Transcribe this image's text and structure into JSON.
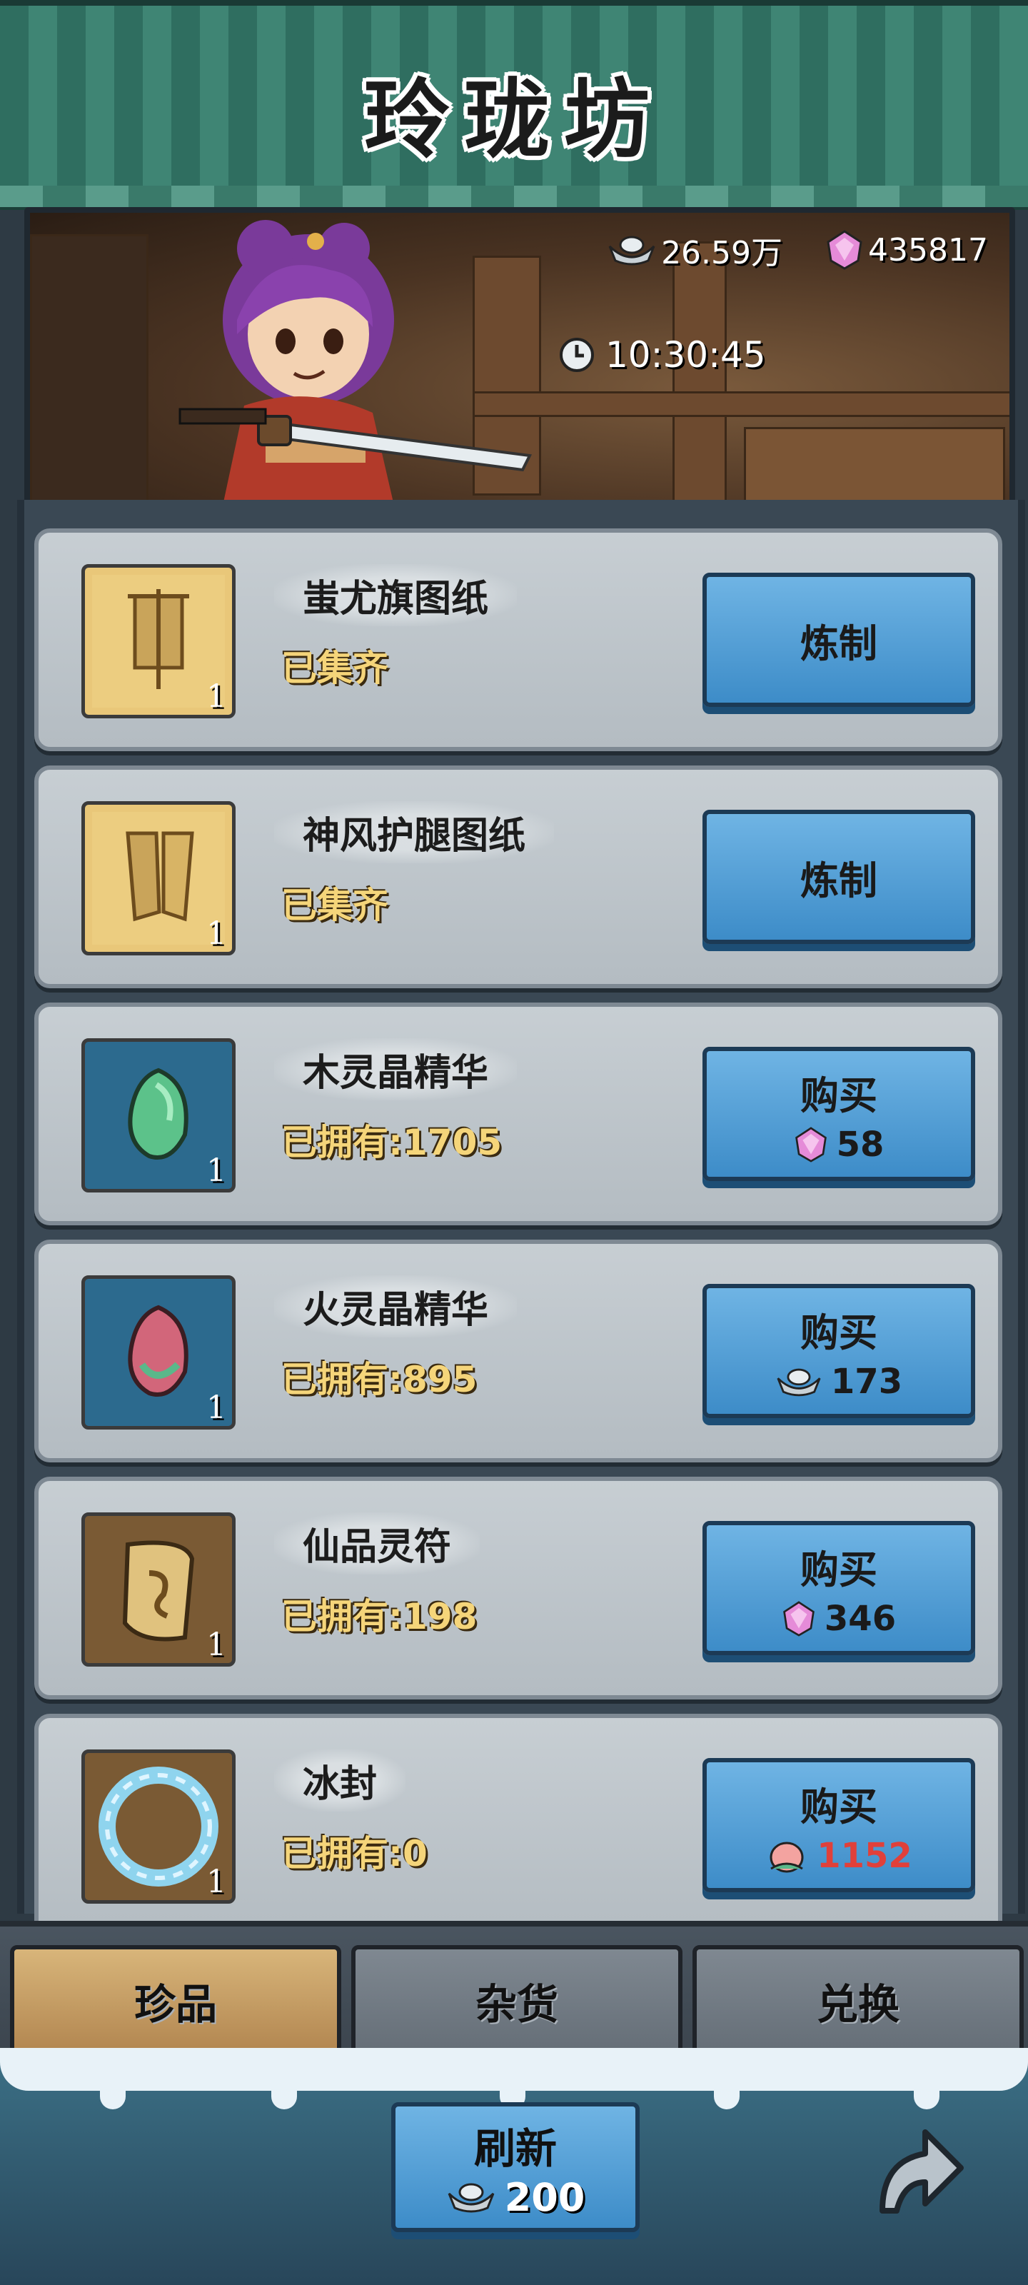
{
  "header": {
    "title": "玲珑坊"
  },
  "banner": {
    "silver": "26.59万",
    "gems": "435817",
    "timer": "10:30:45"
  },
  "items": [
    {
      "name": "蚩尤旗图纸",
      "status": "已集齐",
      "qty": "1",
      "icon": "banner-blueprint-icon",
      "button": {
        "label": "炼制",
        "price": "",
        "currency": ""
      }
    },
    {
      "name": "神风护腿图纸",
      "status": "已集齐",
      "qty": "1",
      "icon": "legguard-blueprint-icon",
      "button": {
        "label": "炼制",
        "price": "",
        "currency": ""
      }
    },
    {
      "name": "木灵晶精华",
      "status": "已拥有:1705",
      "qty": "1",
      "icon": "green-crystal-icon",
      "button": {
        "label": "购买",
        "price": "58",
        "currency": "gem"
      }
    },
    {
      "name": "火灵晶精华",
      "status": "已拥有:895",
      "qty": "1",
      "icon": "red-crystal-icon",
      "button": {
        "label": "购买",
        "price": "173",
        "currency": "silver"
      }
    },
    {
      "name": "仙品灵符",
      "status": "已拥有:198",
      "qty": "1",
      "icon": "talisman-scroll-icon",
      "button": {
        "label": "购买",
        "price": "346",
        "currency": "gem"
      }
    },
    {
      "name": "冰封",
      "status": "已拥有:0",
      "qty": "1",
      "icon": "ice-ring-icon",
      "button": {
        "label": "购买",
        "price": "1152",
        "currency": "peach",
        "price_color": "#e0403a"
      }
    }
  ],
  "tabs": [
    "珍品",
    "杂货",
    "兑换"
  ],
  "active_tab": 0,
  "refresh": {
    "label": "刷新",
    "price": "200"
  },
  "colors": {
    "accent_blue": "#4a9ad6",
    "gold_text": "#f5d57a",
    "peach_price": "#e0403a",
    "awning_green": "#3f8574"
  }
}
